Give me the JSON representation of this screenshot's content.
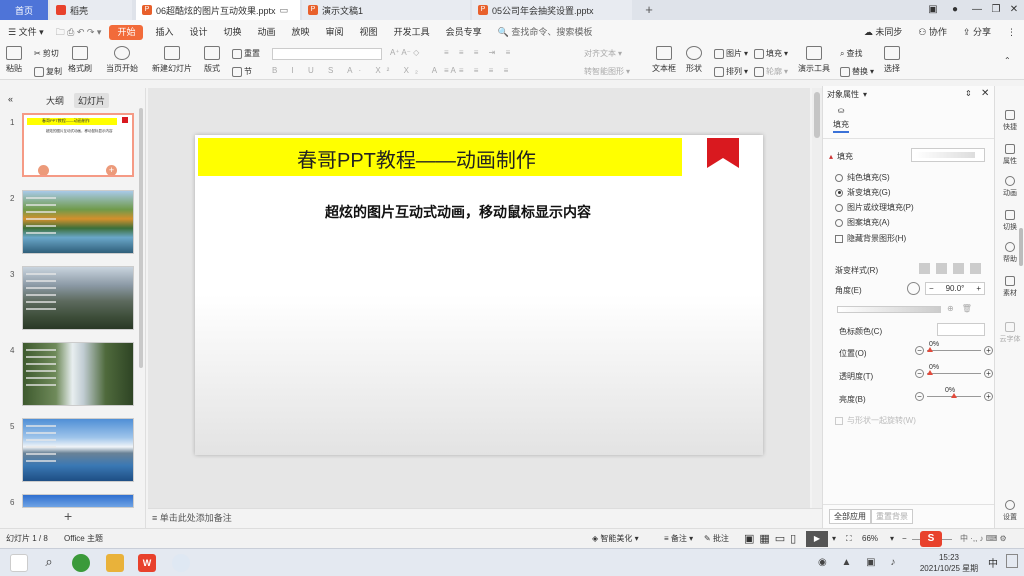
{
  "tabs": {
    "home": "首页",
    "docer": "稻壳",
    "active_doc": "06超酷炫的图片互动效果.pptx",
    "doc2": "演示文稿1",
    "doc3": "05公司年会抽奖设置.pptx"
  },
  "menu": {
    "file": "文件",
    "items": [
      "开始",
      "插入",
      "设计",
      "切换",
      "动画",
      "放映",
      "审阅",
      "视图",
      "开发工具",
      "会员专享"
    ],
    "search": "查找命令、搜索模板",
    "unsync": "未同步",
    "collab": "协作",
    "share": "分享"
  },
  "toolbar": {
    "paste": "粘贴",
    "cut": "剪切",
    "copy": "复制",
    "format_painter": "格式刷",
    "play_from_current": "当页开始",
    "new_slide": "新建幻灯片",
    "layout": "版式",
    "section": "节",
    "reset": "重置",
    "align_text": "对齐文本",
    "convert_smartart": "转智能图形",
    "textbox": "文本框",
    "shapes": "形状",
    "arrange": "排列",
    "picture": "图片",
    "fill": "填充",
    "outline": "轮廓",
    "present_tools": "演示工具",
    "find": "查找",
    "replace": "替换",
    "select": "选择"
  },
  "left_panel": {
    "tab_outline": "大纲",
    "tab_slides": "幻灯片",
    "thumbs": [
      {
        "num": "1",
        "title": "春哥PPT教程——动画制作",
        "sub": "超炫的图片互动式动画，移动鼠标显示内容"
      },
      {
        "num": "2"
      },
      {
        "num": "3"
      },
      {
        "num": "4"
      },
      {
        "num": "5"
      },
      {
        "num": "6"
      }
    ]
  },
  "slide": {
    "title": "春哥PPT教程——动画制作",
    "subtitle": "超炫的图片互动式动画，移动鼠标显示内容"
  },
  "notes_placeholder": "单击此处添加备注",
  "right_panel": {
    "header": "对象属性",
    "tab_fill": "填充",
    "section_fill": "填充",
    "fill_options": [
      "纯色填充(S)",
      "渐变填充(G)",
      "图片或纹理填充(P)",
      "图案填充(A)"
    ],
    "selected_fill": "渐变填充(G)",
    "hide_bg": "隐藏背景图形(H)",
    "gradient_style": "渐变样式(R)",
    "angle_label": "角度(E)",
    "angle_value": "90.0°",
    "stop_color": "色标颜色(C)",
    "position_label": "位置(O)",
    "position_value": "0%",
    "transparency_label": "透明度(T)",
    "transparency_value": "0%",
    "brightness_label": "亮度(B)",
    "brightness_value": "0%",
    "rotate_with_shape": "与形状一起旋转(W)",
    "apply_all": "全部应用",
    "reset_bg": "重置背景"
  },
  "right_rail": [
    "快捷",
    "属性",
    "动画",
    "切换",
    "帮助",
    "素材",
    "云字体",
    "设置"
  ],
  "status": {
    "slide_count": "幻灯片 1 / 8",
    "theme": "Office 主题",
    "beautify": "智能美化",
    "notes": "备注",
    "comments": "批注",
    "zoom": "66%"
  },
  "taskbar": {
    "time": "15:23",
    "date": "2021/10/25 星期一",
    "ime": "中"
  }
}
